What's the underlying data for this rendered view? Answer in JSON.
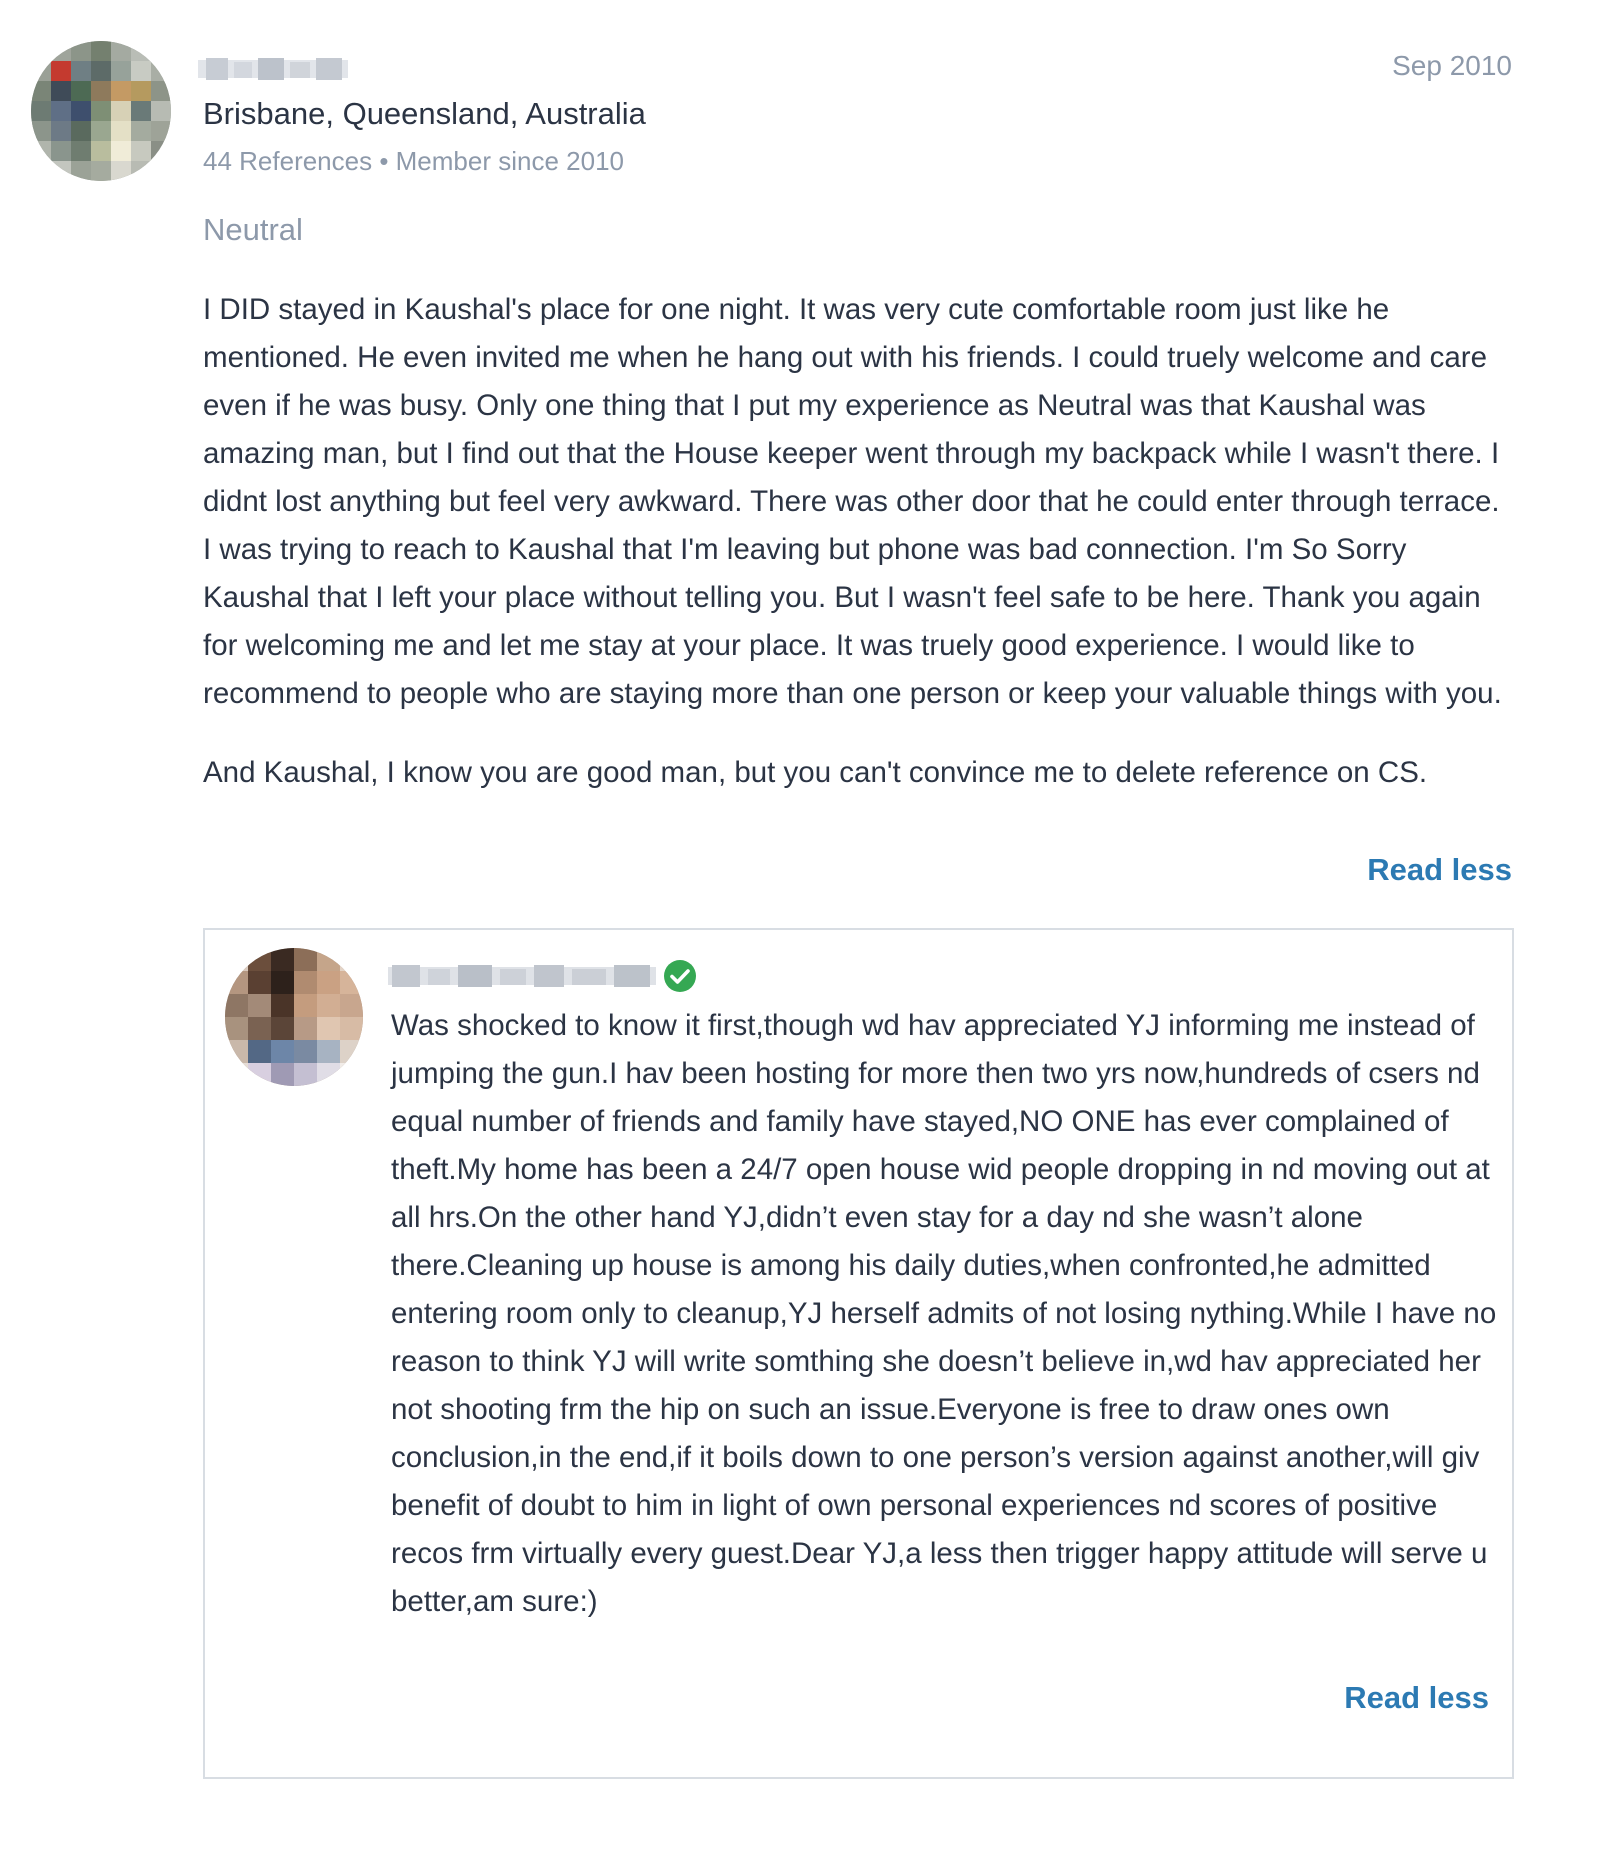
{
  "review": {
    "date": "Sep 2010",
    "location": "Brisbane, Queensland, Australia",
    "meta": "44 References • Member since 2010",
    "experience": "Neutral",
    "body_paragraphs": [
      "I DID stayed in Kaushal's place for one night. It was very cute comfortable room just like he mentioned. He even invited me when he hang out with his friends. I could truely welcome and care even if he was busy. Only one thing that I put my experience as Neutral was that Kaushal was amazing man, but I find out that the House keeper went through my backpack while I wasn't there. I didnt lost anything but feel very awkward. There was other door that he could enter through terrace. I was trying to reach to Kaushal that I'm leaving but phone was bad connection. I'm So Sorry Kaushal that I left your place without telling you. But I wasn't feel safe to be here. Thank you again for welcoming me and let me stay at your place. It was truely good experience. I would like to recommend to people who are staying more than one person or keep your valuable things with you.",
      "And Kaushal, I know you are good man, but you can't convince me to delete reference on CS."
    ],
    "read_less_label": "Read less"
  },
  "response": {
    "verified_icon": "check-circle-icon",
    "verified_color": "#35a853",
    "body": "Was shocked to know it first,though wd hav appreciated YJ informing me instead of jumping the gun.I hav been hosting for more then two yrs now,hundreds of csers nd equal number of friends and family have stayed,NO ONE has ever complained of theft.My home has been a 24/7 open house wid people dropping in nd moving out at all hrs.On the other hand YJ,didn’t even stay for a day nd she wasn’t alone there.Cleaning up house is among his daily duties,when confronted,he admitted entering room only to cleanup,YJ herself admits of not losing nything.While I have no reason to think YJ will write somthing she doesn’t believe in,wd hav appreciated her not shooting frm the hip on such an issue.Everyone is free to draw ones own conclusion,in the end,if it boils down to one person’s version against another,will giv benefit of doubt to him in light of own personal experiences nd scores of positive recos frm virtually every guest.Dear YJ,a less then trigger happy attitude will serve u better,am sure:)",
    "read_less_label": "Read less"
  },
  "colors": {
    "text": "#2b3444",
    "muted": "#8d99aa",
    "link": "#2c7ab3",
    "border": "#d8dde3"
  }
}
